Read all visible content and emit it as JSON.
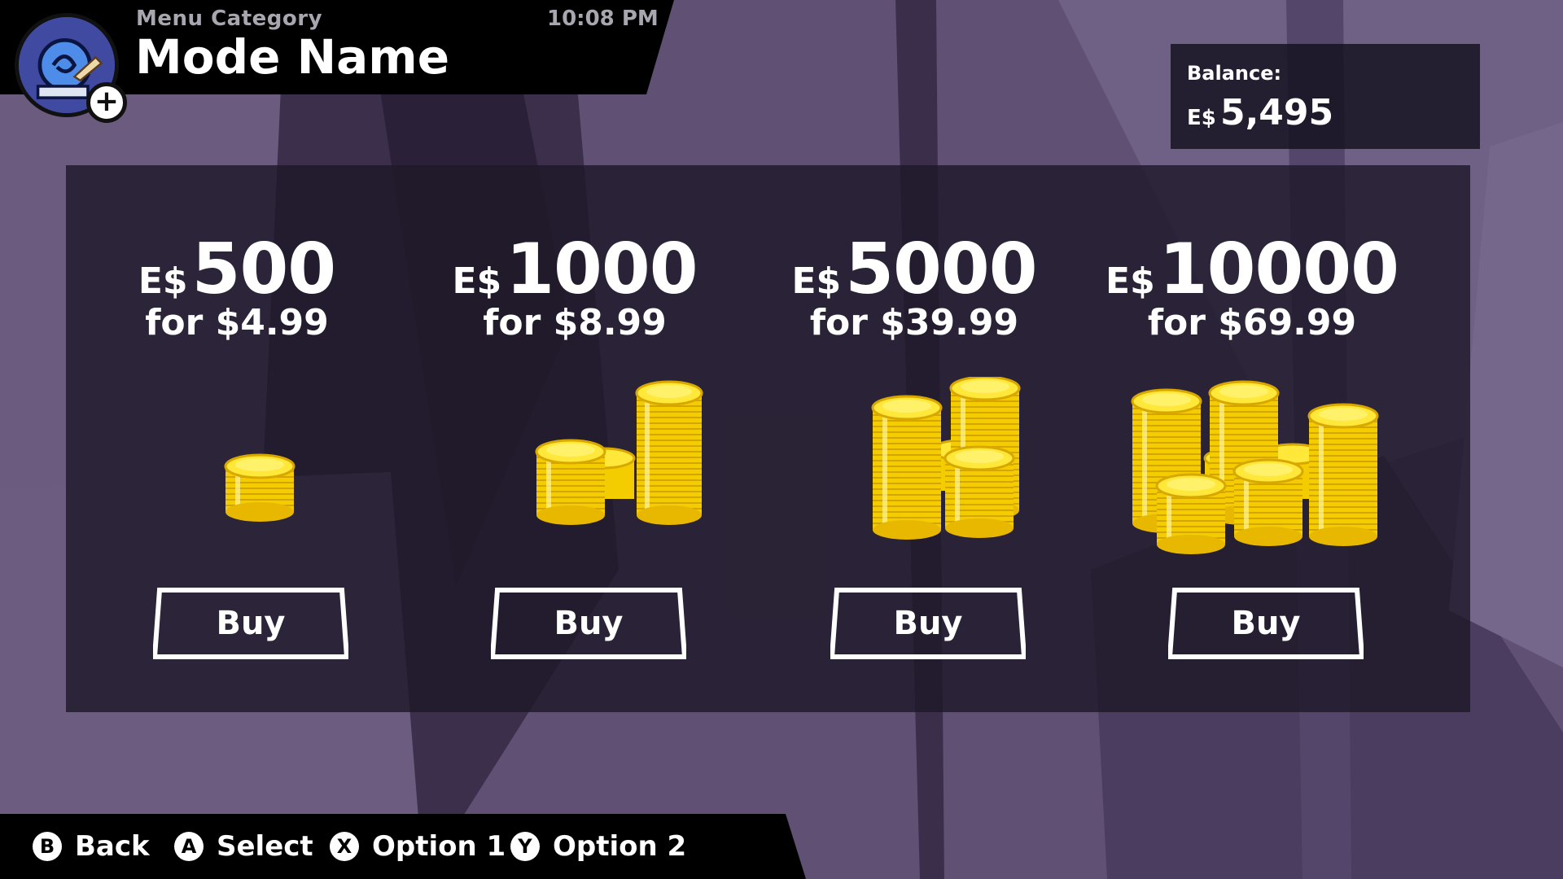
{
  "header": {
    "category": "Menu Category",
    "time": "10:08 PM",
    "mode_name": "Mode Name",
    "avatar_icon": "player-avatar",
    "add_icon": "plus-icon"
  },
  "balance": {
    "label": "Balance:",
    "currency": "E$",
    "amount": "5,495"
  },
  "offers": [
    {
      "currency": "E$",
      "amount": "500",
      "price": "for $4.99",
      "button": "Buy"
    },
    {
      "currency": "E$",
      "amount": "1000",
      "price": "for $8.99",
      "button": "Buy"
    },
    {
      "currency": "E$",
      "amount": "5000",
      "price": "for $39.99",
      "button": "Buy"
    },
    {
      "currency": "E$",
      "amount": "10000",
      "price": "for $69.99",
      "button": "Buy"
    }
  ],
  "footer": {
    "hints": [
      {
        "button": "B",
        "label": "Back"
      },
      {
        "button": "A",
        "label": "Select"
      },
      {
        "button": "X",
        "label": "Option 1"
      },
      {
        "button": "Y",
        "label": "Option 2"
      }
    ]
  },
  "colors": {
    "coin_gold": "#f6d200",
    "coin_shadow": "#d9a800",
    "panel": "#1e1928",
    "background": "#5e4f72"
  }
}
